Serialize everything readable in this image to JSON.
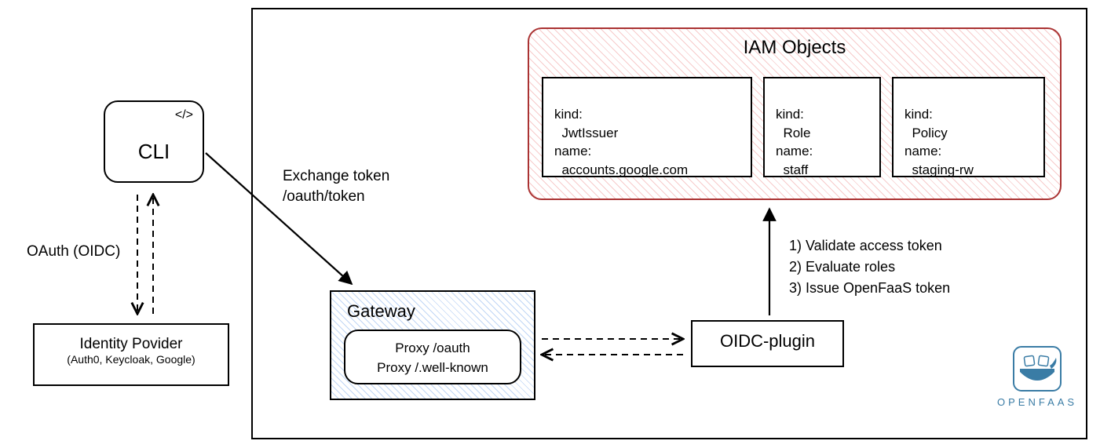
{
  "cli": {
    "label": "CLI",
    "icon_hint": "</>"
  },
  "idp": {
    "title": "Identity Povider",
    "subtitle": "(Auth0, Keycloak, Google)"
  },
  "oauth_label": "OAuth (OIDC)",
  "exchange_label_line1": "Exchange token",
  "exchange_label_line2": "/oauth/token",
  "container_note": "",
  "iam": {
    "title": "IAM Objects",
    "objects": [
      {
        "line1": "kind:",
        "line2": "  JwtIssuer",
        "line3": "name:",
        "line4": "  accounts.google.com"
      },
      {
        "line1": "kind:",
        "line2": "  Role",
        "line3": "name:",
        "line4": "  staff"
      },
      {
        "line1": "kind:",
        "line2": "  Policy",
        "line3": "name:",
        "line4": "  staging-rw"
      }
    ]
  },
  "gateway": {
    "title": "Gateway",
    "proxy_line1": "Proxy /oauth",
    "proxy_line2": "Proxy /.well-known"
  },
  "oidc_plugin": {
    "label": "OIDC-plugin"
  },
  "steps": {
    "s1": "1) Validate access token",
    "s2": "2) Evaluate roles",
    "s3": "3) Issue OpenFaaS token"
  },
  "logo": {
    "text": "OPENFAAS"
  }
}
